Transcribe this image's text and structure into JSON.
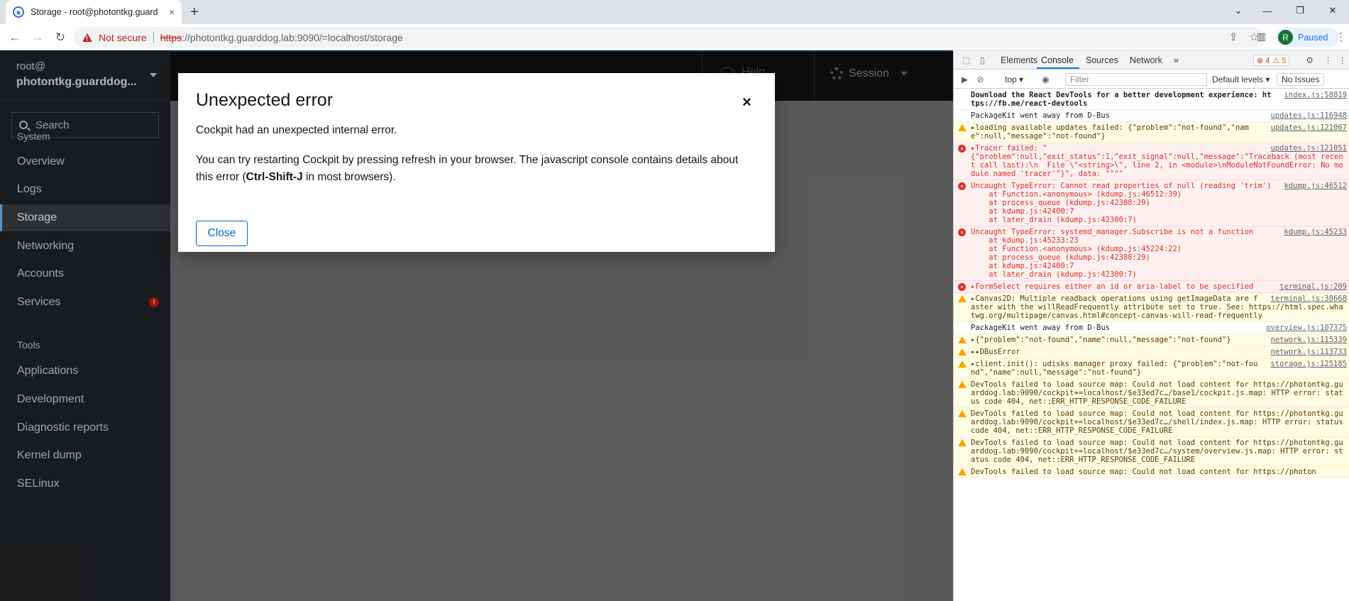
{
  "browser": {
    "tab_title": "Storage - root@photontkg.guarddog.lab",
    "tab_close": "×",
    "new_tab": "+",
    "security_label": "Not secure",
    "url_scheme": "https",
    "url_rest": "://photontkg.guarddog.lab:9090/=localhost/storage",
    "profile_initial": "R",
    "profile_status": "Paused"
  },
  "sidebar": {
    "user": "root@",
    "host": "photontkg.guarddog...",
    "search_placeholder": "Search",
    "sections": [
      {
        "label": "System"
      },
      {
        "label": "Tools"
      }
    ],
    "items": [
      {
        "label": "Overview",
        "active": false
      },
      {
        "label": "Logs",
        "active": false
      },
      {
        "label": "Storage",
        "active": true
      },
      {
        "label": "Networking",
        "active": false
      },
      {
        "label": "Accounts",
        "active": false
      },
      {
        "label": "Services",
        "active": false,
        "alert": true
      },
      {
        "label": "Applications",
        "active": false
      },
      {
        "label": "Development",
        "active": false
      },
      {
        "label": "Diagnostic reports",
        "active": false
      },
      {
        "label": "Kernel dump",
        "active": false
      },
      {
        "label": "SELinux",
        "active": false
      }
    ]
  },
  "masthead": {
    "help_label": "Help",
    "session_label": "Session"
  },
  "modal": {
    "title": "Unexpected error",
    "message": "Cockpit had an unexpected internal error.",
    "detail_before": "You can try restarting Cockpit by pressing refresh in your browser. The javascript console contains details about this error (",
    "detail_shortcut": "Ctrl-Shift-J",
    "detail_after": " in most browsers).",
    "close_button": "Close",
    "close_icon": "×"
  },
  "devtools": {
    "tabs": [
      "Elements",
      "Console",
      "Sources",
      "Network"
    ],
    "active_tab": "Console",
    "more_tabs": "»",
    "error_count": "4",
    "warning_count": "5",
    "context": "top",
    "filter_placeholder": "Filter",
    "levels": "Default levels ▾",
    "issues": "No Issues",
    "messages": [
      {
        "level": "info",
        "source": "index.js:58819",
        "text": "Download the React DevTools for a better development experience: https://fb.me/react-devtools",
        "bold": true
      },
      {
        "level": "info",
        "source": "updates.js:116948",
        "text": "PackageKit went away from D-Bus"
      },
      {
        "level": "warning",
        "source": "updates.js:121067",
        "text": "▸loading available updates failed: {\"problem\":\"not-found\",\"name\":null,\"message\":\"not-found\"}"
      },
      {
        "level": "error",
        "source": "updates.js:121051",
        "text": "▸Tracer failed: \"\n{\"problem\":null,\"exit_status\":1,\"exit_signal\":null,\"message\":\"Traceback (most recent call last):\\n  File \\\"<string>\\\", line 2, in <module>\\nModuleNotFoundError: No module named 'tracer'\"}\", data: \"\"\"\""
      },
      {
        "level": "error",
        "source": "kdump.js:46512",
        "text": "Uncaught TypeError: Cannot read properties of null (reading 'trim')\n    at Function.<anonymous> (kdump.js:46512:39)\n    at process_queue (kdump.js:42388:29)\n    at kdump.js:42400:7\n    at later_drain (kdump.js:42300:7)"
      },
      {
        "level": "error",
        "source": "kdump.js:45233",
        "text": "Uncaught TypeError: systemd_manager.Subscribe is not a function\n    at kdump.js:45233:23\n    at Function.<anonymous> (kdump.js:45224:22)\n    at process_queue (kdump.js:42388:29)\n    at kdump.js:42400:7\n    at later_drain (kdump.js:42300:7)"
      },
      {
        "level": "error",
        "source": "terminal.js:209",
        "text": "▸FormSelect requires either an id or aria-label to be specified"
      },
      {
        "level": "warning",
        "source": "terminal.js:38668",
        "text": "▸Canvas2D: Multiple readback operations using getImageData are faster with the willReadFrequently attribute set to true. See: https://html.spec.whatwg.org/multipage/canvas.html#concept-canvas-will-read-frequently"
      },
      {
        "level": "info",
        "source": "overview.js:107375",
        "text": "PackageKit went away from D-Bus"
      },
      {
        "level": "warning",
        "source": "network.js:115339",
        "text": "▸{\"problem\":\"not-found\",\"name\":null,\"message\":\"not-found\"}"
      },
      {
        "level": "warning",
        "source": "network.js:113733",
        "text": "▸▸DBusError"
      },
      {
        "level": "warning",
        "source": "storage.js:125185",
        "text": "▸client.init(): udisks manager proxy failed: {\"problem\":\"not-found\",\"name\":null,\"message\":\"not-found\"}"
      },
      {
        "level": "warning",
        "source": "",
        "text": "DevTools failed to load source map: Could not load content for https://photontkg.guarddog.lab:9090/cockpit+=localhost/$e33ed7c…/base1/cockpit.js.map: HTTP error: status code 404, net::ERR_HTTP_RESPONSE_CODE_FAILURE"
      },
      {
        "level": "warning",
        "source": "",
        "text": "DevTools failed to load source map: Could not load content for https://photontkg.guarddog.lab:9090/cockpit+=localhost/$e33ed7c…/shell/index.js.map: HTTP error: status code 404, net::ERR_HTTP_RESPONSE_CODE_FAILURE"
      },
      {
        "level": "warning",
        "source": "",
        "text": "DevTools failed to load source map: Could not load content for https://photontkg.guarddog.lab:9090/cockpit+=localhost/$e33ed7c…/system/overview.js.map: HTTP error: status code 404, net::ERR_HTTP_RESPONSE_CODE_FAILURE"
      },
      {
        "level": "warning",
        "source": "",
        "text": "DevTools failed to load source map: Could not load content for https://photon"
      }
    ]
  }
}
